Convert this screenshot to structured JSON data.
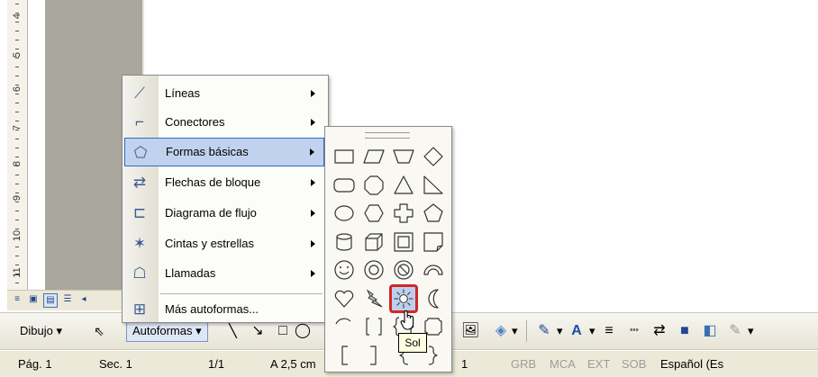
{
  "ruler": {
    "numbers": [
      "4",
      "5",
      "6",
      "7",
      "8",
      "9",
      "10",
      "11"
    ]
  },
  "menu": {
    "items": [
      {
        "label": "Líneas",
        "icon": "lines-icon",
        "submenu": true,
        "highlighted": false
      },
      {
        "label": "Conectores",
        "icon": "connectors-icon",
        "submenu": true,
        "highlighted": false
      },
      {
        "label": "Formas básicas",
        "icon": "basic-shapes-icon",
        "submenu": true,
        "highlighted": true
      },
      {
        "label": "Flechas de bloque",
        "icon": "block-arrows-icon",
        "submenu": true,
        "highlighted": false
      },
      {
        "label": "Diagrama de flujo",
        "icon": "flowchart-icon",
        "submenu": true,
        "highlighted": false
      },
      {
        "label": "Cintas y estrellas",
        "icon": "stars-banners-icon",
        "submenu": true,
        "highlighted": false
      },
      {
        "label": "Llamadas",
        "icon": "callouts-icon",
        "submenu": true,
        "highlighted": false
      },
      {
        "label": "Más autoformas...",
        "icon": "more-autoshapes-icon",
        "submenu": false,
        "highlighted": false
      }
    ]
  },
  "palette": {
    "shapes": [
      "rectangle",
      "parallelogram",
      "trapezoid",
      "diamond",
      "rounded-rectangle",
      "octagon",
      "isosceles-triangle",
      "right-triangle",
      "oval",
      "hexagon",
      "cross",
      "pentagon",
      "can",
      "cube",
      "bevel",
      "folded-corner",
      "smiley-face",
      "donut",
      "no-symbol",
      "block-arc",
      "heart",
      "lightning-bolt",
      "sun",
      "moon",
      "arc",
      "double-bracket",
      "double-brace",
      "plaque",
      "left-bracket",
      "right-bracket",
      "left-brace",
      "right-brace"
    ],
    "selected": "sun",
    "tooltip": "Sol"
  },
  "toolbar": {
    "dibujo_label": "Dibujo",
    "autoformas_label": "Autoformas"
  },
  "statusbar": {
    "page": "Pág. 1",
    "section": "Sec. 1",
    "pages": "1/1",
    "position": "A 2,5 cm",
    "line": "1",
    "grb": "GRB",
    "mca": "MCA",
    "ext": "EXT",
    "sob": "SOB",
    "language": "Español (Es"
  },
  "colors": {
    "highlight": "#c1d2ee",
    "selected_border": "#d32626",
    "toolbar_bg": "#ece9d8"
  }
}
